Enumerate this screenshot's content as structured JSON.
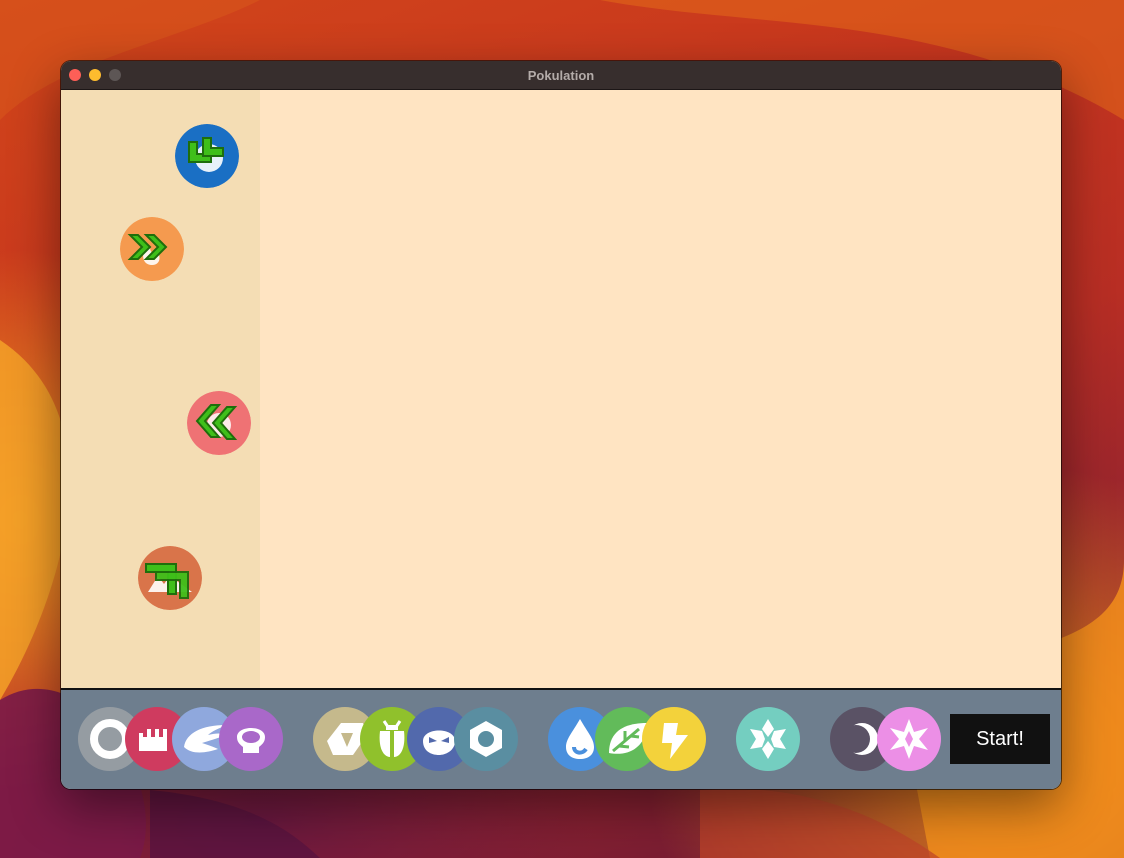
{
  "window": {
    "title": "Pokulation"
  },
  "board": {
    "pieces": [
      {
        "type": "water",
        "color": "#1a6fc4",
        "arrow": "down-left-turn"
      },
      {
        "type": "fire",
        "color": "#f59a4f",
        "arrow": "double-right"
      },
      {
        "type": "fairy",
        "color": "#ef7274",
        "arrow": "double-left"
      },
      {
        "type": "ground",
        "color": "#d9744a",
        "arrow": "up-right-turn"
      }
    ]
  },
  "toolbar": {
    "types": [
      {
        "name": "normal",
        "color": "#959ca2",
        "icon": "ring-icon"
      },
      {
        "name": "fighting",
        "color": "#cf3b5f",
        "icon": "fist-icon"
      },
      {
        "name": "flying",
        "color": "#8fa8dd",
        "icon": "wing-icon"
      },
      {
        "name": "poison",
        "color": "#a968c9",
        "icon": "skull-icon"
      },
      {
        "name": "rock",
        "color": "#c5b98c",
        "icon": "rock-icon"
      },
      {
        "name": "bug",
        "color": "#90c12c",
        "icon": "bug-icon"
      },
      {
        "name": "ghost",
        "color": "#5269ac",
        "icon": "ghost-icon"
      },
      {
        "name": "steel",
        "color": "#5a8ea1",
        "icon": "nut-icon"
      },
      {
        "name": "water",
        "color": "#4a90dd",
        "icon": "drop-icon"
      },
      {
        "name": "grass",
        "color": "#62bb5a",
        "icon": "leaf-icon"
      },
      {
        "name": "electric",
        "color": "#f3d23b",
        "icon": "bolt-icon"
      },
      {
        "name": "ice",
        "color": "#74cec0",
        "icon": "snowflake-icon"
      },
      {
        "name": "dark",
        "color": "#5a5265",
        "icon": "moon-icon"
      },
      {
        "name": "fairy",
        "color": "#ec8fe6",
        "icon": "sparkle-icon"
      }
    ],
    "start_label": "Start!"
  }
}
